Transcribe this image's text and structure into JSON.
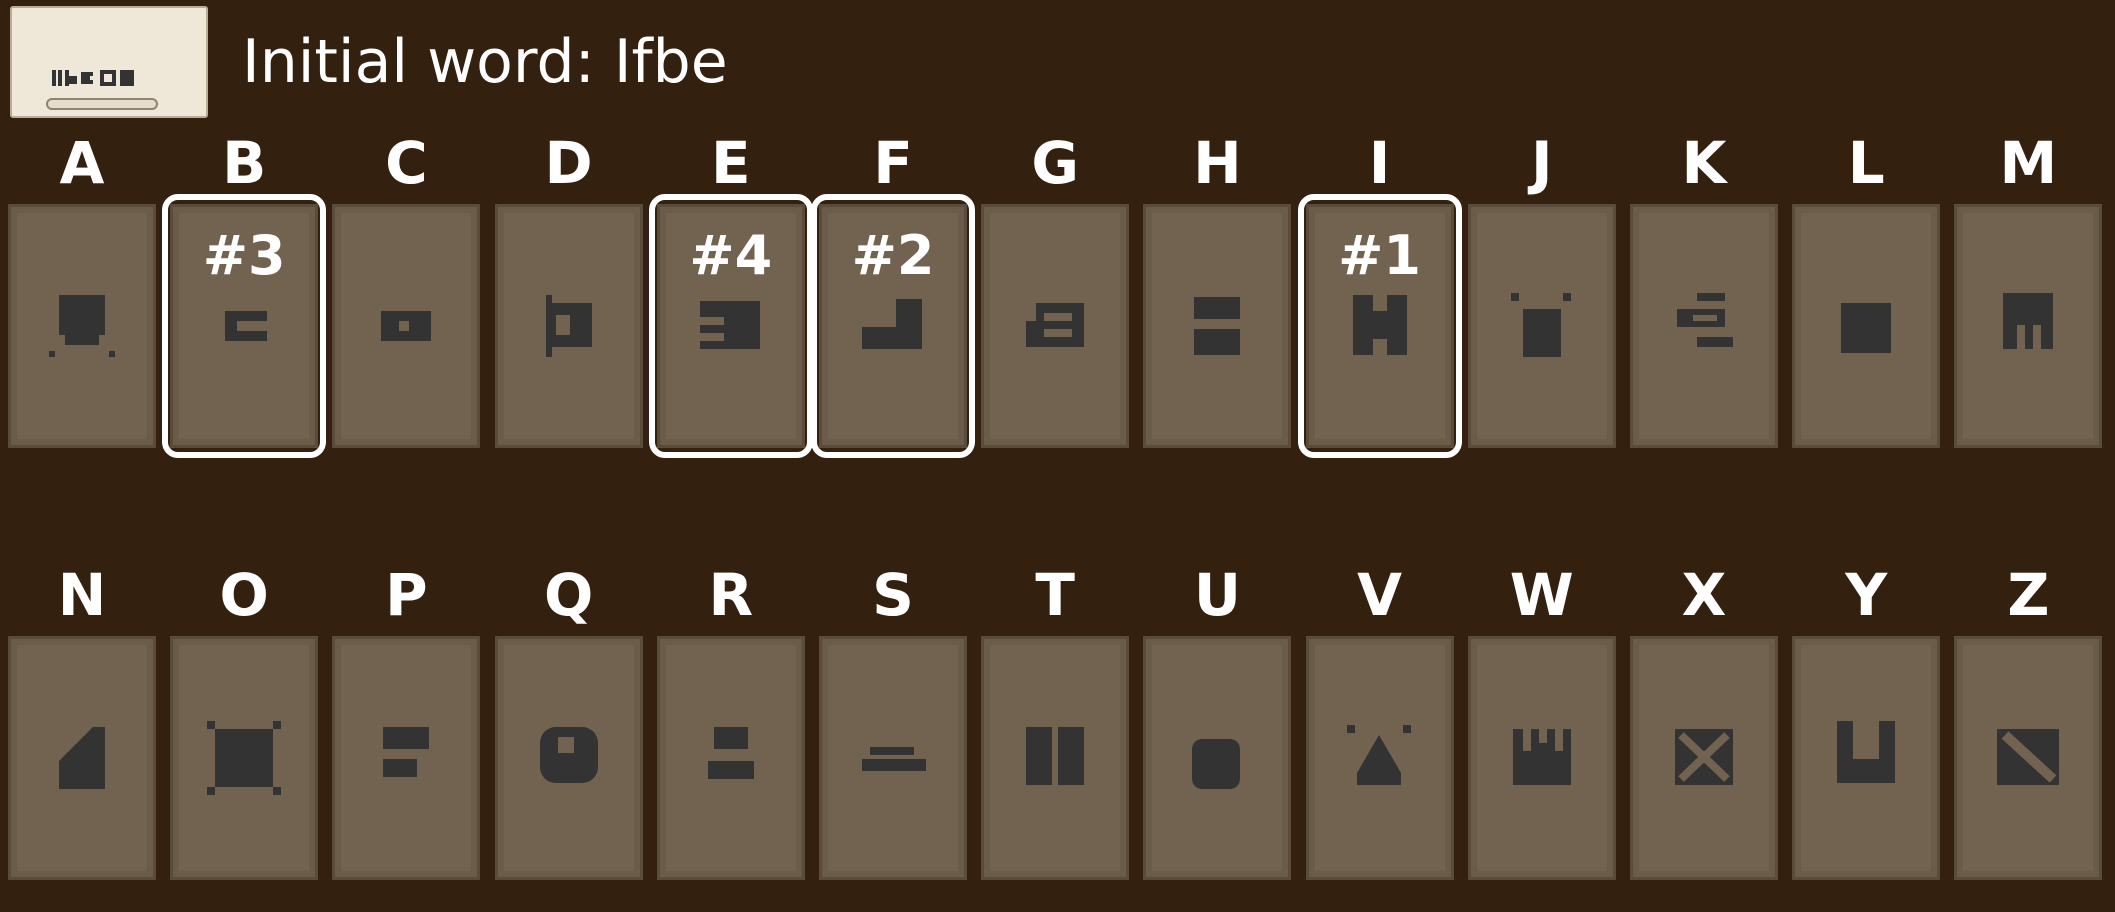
{
  "header": {
    "title": "Initial word: Ifbe",
    "word_card_glyphs": [
      "I",
      "F",
      "B",
      "E"
    ]
  },
  "colors": {
    "background": "#33200f",
    "card": "#726250",
    "glyph": "#333333",
    "selection": "#ffffff"
  },
  "rows": [
    {
      "letters": [
        "A",
        "B",
        "C",
        "D",
        "E",
        "F",
        "G",
        "H",
        "I",
        "J",
        "K",
        "L",
        "M"
      ]
    },
    {
      "letters": [
        "N",
        "O",
        "P",
        "Q",
        "R",
        "S",
        "T",
        "U",
        "V",
        "W",
        "X",
        "Y",
        "Z"
      ]
    }
  ],
  "selections": [
    {
      "letter": "I",
      "label": "#1"
    },
    {
      "letter": "F",
      "label": "#2"
    },
    {
      "letter": "B",
      "label": "#3"
    },
    {
      "letter": "E",
      "label": "#4"
    }
  ]
}
